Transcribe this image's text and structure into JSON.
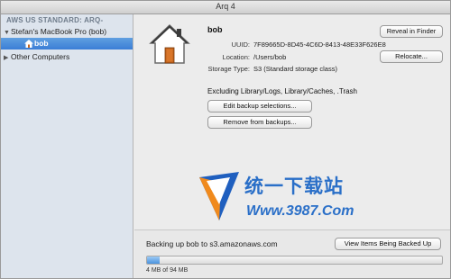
{
  "window": {
    "title": "Arq 4"
  },
  "sidebar": {
    "header": "AWS US STANDARD: ARQ-",
    "computer": "Stefan's MacBook Pro (bob)",
    "selected_item": "bob",
    "other": "Other Computers"
  },
  "folder": {
    "name": "bob",
    "uuid_label": "UUID:",
    "uuid": "7F89665D-8D45-4C6D-8413-48E33F626E8",
    "location_label": "Location:",
    "location": "/Users/bob",
    "storage_label": "Storage Type:",
    "storage": "S3 (Standard storage class)",
    "excluding": "Excluding Library/Logs, Library/Caches, .Trash",
    "reveal_button": "Reveal in Finder",
    "relocate_button": "Relocate...",
    "edit_button": "Edit backup selections...",
    "remove_button": "Remove from backups..."
  },
  "watermark": {
    "cn": "统一下载站",
    "url": "Www.3987.Com"
  },
  "status": {
    "text": "Backing up bob to s3.amazonaws.com",
    "view_button": "View Items Being Backed Up",
    "progress_text": "4 MB of 94 MB",
    "progress_fraction": 0.043
  },
  "colors": {
    "selection": "#3b7ed6",
    "sidebar_bg": "#dde4ed",
    "progress_fill": "#4b92de"
  },
  "icons": {
    "house": "house-icon",
    "home_small": "home-small-icon",
    "watermark_logo": "download-logo-icon"
  }
}
